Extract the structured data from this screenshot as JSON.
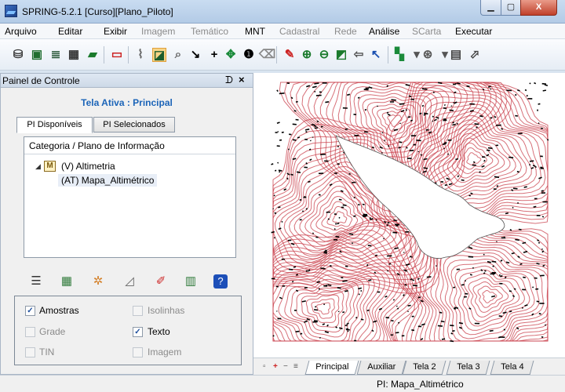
{
  "window": {
    "title": "SPRING-5.2.1 [Curso][Plano_Piloto]"
  },
  "menu": [
    {
      "label": "Arquivo",
      "enabled": true
    },
    {
      "label": "Editar",
      "enabled": true
    },
    {
      "label": "Exibir",
      "enabled": true
    },
    {
      "label": "Imagem",
      "enabled": false
    },
    {
      "label": "Temático",
      "enabled": false
    },
    {
      "label": "MNT",
      "enabled": true
    },
    {
      "label": "Cadastral",
      "enabled": false
    },
    {
      "label": "Rede",
      "enabled": false
    },
    {
      "label": "Análise",
      "enabled": true
    },
    {
      "label": "SCarta",
      "enabled": false
    },
    {
      "label": "Executar",
      "enabled": true
    }
  ],
  "control_panel": {
    "title": "Painel de Controle",
    "pin": "ᗪ",
    "close": "×",
    "active_view": "Tela Ativa : Principal",
    "tabs": [
      "PI Disponíveis",
      "PI Selecionados"
    ],
    "tree": {
      "header": "Categoria / Plano de Informação",
      "category_icon": "M",
      "category": "(V) Altimetria",
      "plan": "(AT) Mapa_Altimétrico"
    },
    "options": {
      "amostras": {
        "label": "Amostras",
        "checked": true
      },
      "isolinhas": {
        "label": "Isolinhas",
        "checked": false
      },
      "grade": {
        "label": "Grade",
        "checked": false
      },
      "texto": {
        "label": "Texto",
        "checked": true
      },
      "tin": {
        "label": "TIN",
        "checked": false
      },
      "imagem": {
        "label": "Imagem",
        "checked": false
      }
    }
  },
  "map_tabs": [
    "Principal",
    "Auxiliar",
    "Tela 2",
    "Tela 3",
    "Tela 4"
  ],
  "status": {
    "pi": "PI: Mapa_Altimétrico"
  },
  "colors": {
    "contour": "#c9404c",
    "samples": "#000000",
    "accent": "#1b64b8"
  }
}
